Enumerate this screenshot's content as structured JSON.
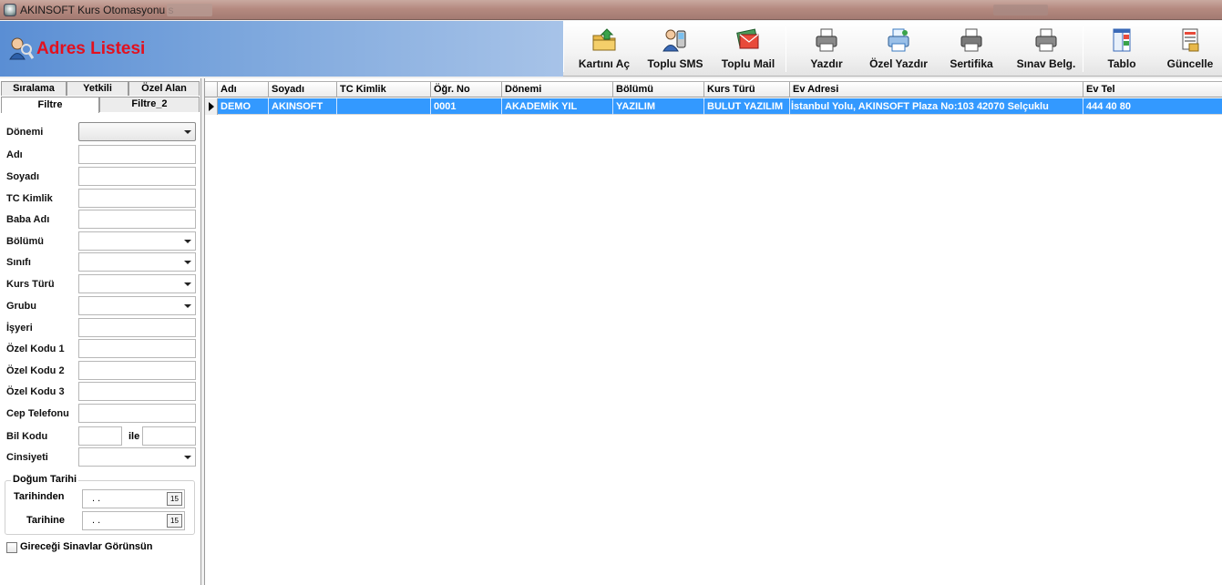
{
  "window": {
    "title": "AKINSOFT Kurs Otomasyonu s"
  },
  "header": {
    "title": "Adres Listesi"
  },
  "toolbar": {
    "buttons": [
      {
        "label": "Kartını Aç"
      },
      {
        "label": "Toplu SMS"
      },
      {
        "label": "Toplu Mail"
      },
      {
        "label": "Yazdır"
      },
      {
        "label": "Özel Yazdır"
      },
      {
        "label": "Sertifika"
      },
      {
        "label": "Sınav Belg."
      },
      {
        "label": "Tablo"
      },
      {
        "label": "Güncelle"
      }
    ]
  },
  "tabs": {
    "row1": [
      "Sıralama",
      "Yetkili",
      "Özel Alan"
    ],
    "row2": [
      "Filtre",
      "Filtre_2"
    ]
  },
  "filter": {
    "donemi": "Dönemi",
    "adi": "Adı",
    "soyadi": "Soyadı",
    "tc_kimlik": "TC Kimlik",
    "baba_adi": "Baba Adı",
    "bolumu": "Bölümü",
    "sinifi": "Sınıfı",
    "kurs_turu": "Kurs Türü",
    "grubu": "Grubu",
    "isyeri": "İşyeri",
    "ozel_kodu_1": "Özel Kodu 1",
    "ozel_kodu_2": "Özel Kodu 2",
    "ozel_kodu_3": "Özel Kodu 3",
    "cep_telefonu": "Cep Telefonu",
    "bil_kodu": "Bil Kodu",
    "ile": "ile",
    "cinsiyeti": "Cinsiyeti",
    "dogum_tarihi": "Doğum Tarihi",
    "tarihinden": "Tarihinden",
    "tarihine": "Tarihine",
    "date_placeholder": ". .",
    "cal_glyph": "15",
    "gireceği": "Gireceği Sinavlar Görünsün"
  },
  "grid": {
    "columns": [
      "Adı",
      "Soyadı",
      "TC Kimlik",
      "Öğr. No",
      "Dönemi",
      "Bölümü",
      "Kurs Türü",
      "Ev Adresi",
      "Ev Tel"
    ],
    "rows": [
      [
        "DEMO",
        "AKINSOFT",
        "",
        "0001",
        "AKADEMİK YIL",
        "YAZILIM",
        "BULUT YAZILIM",
        "İstanbul Yolu, AKINSOFT Plaza No:103 42070 Selçuklu",
        "444 40 80"
      ]
    ]
  },
  "colors": {
    "header_title": "#e3101e",
    "selection": "#3399ff"
  }
}
